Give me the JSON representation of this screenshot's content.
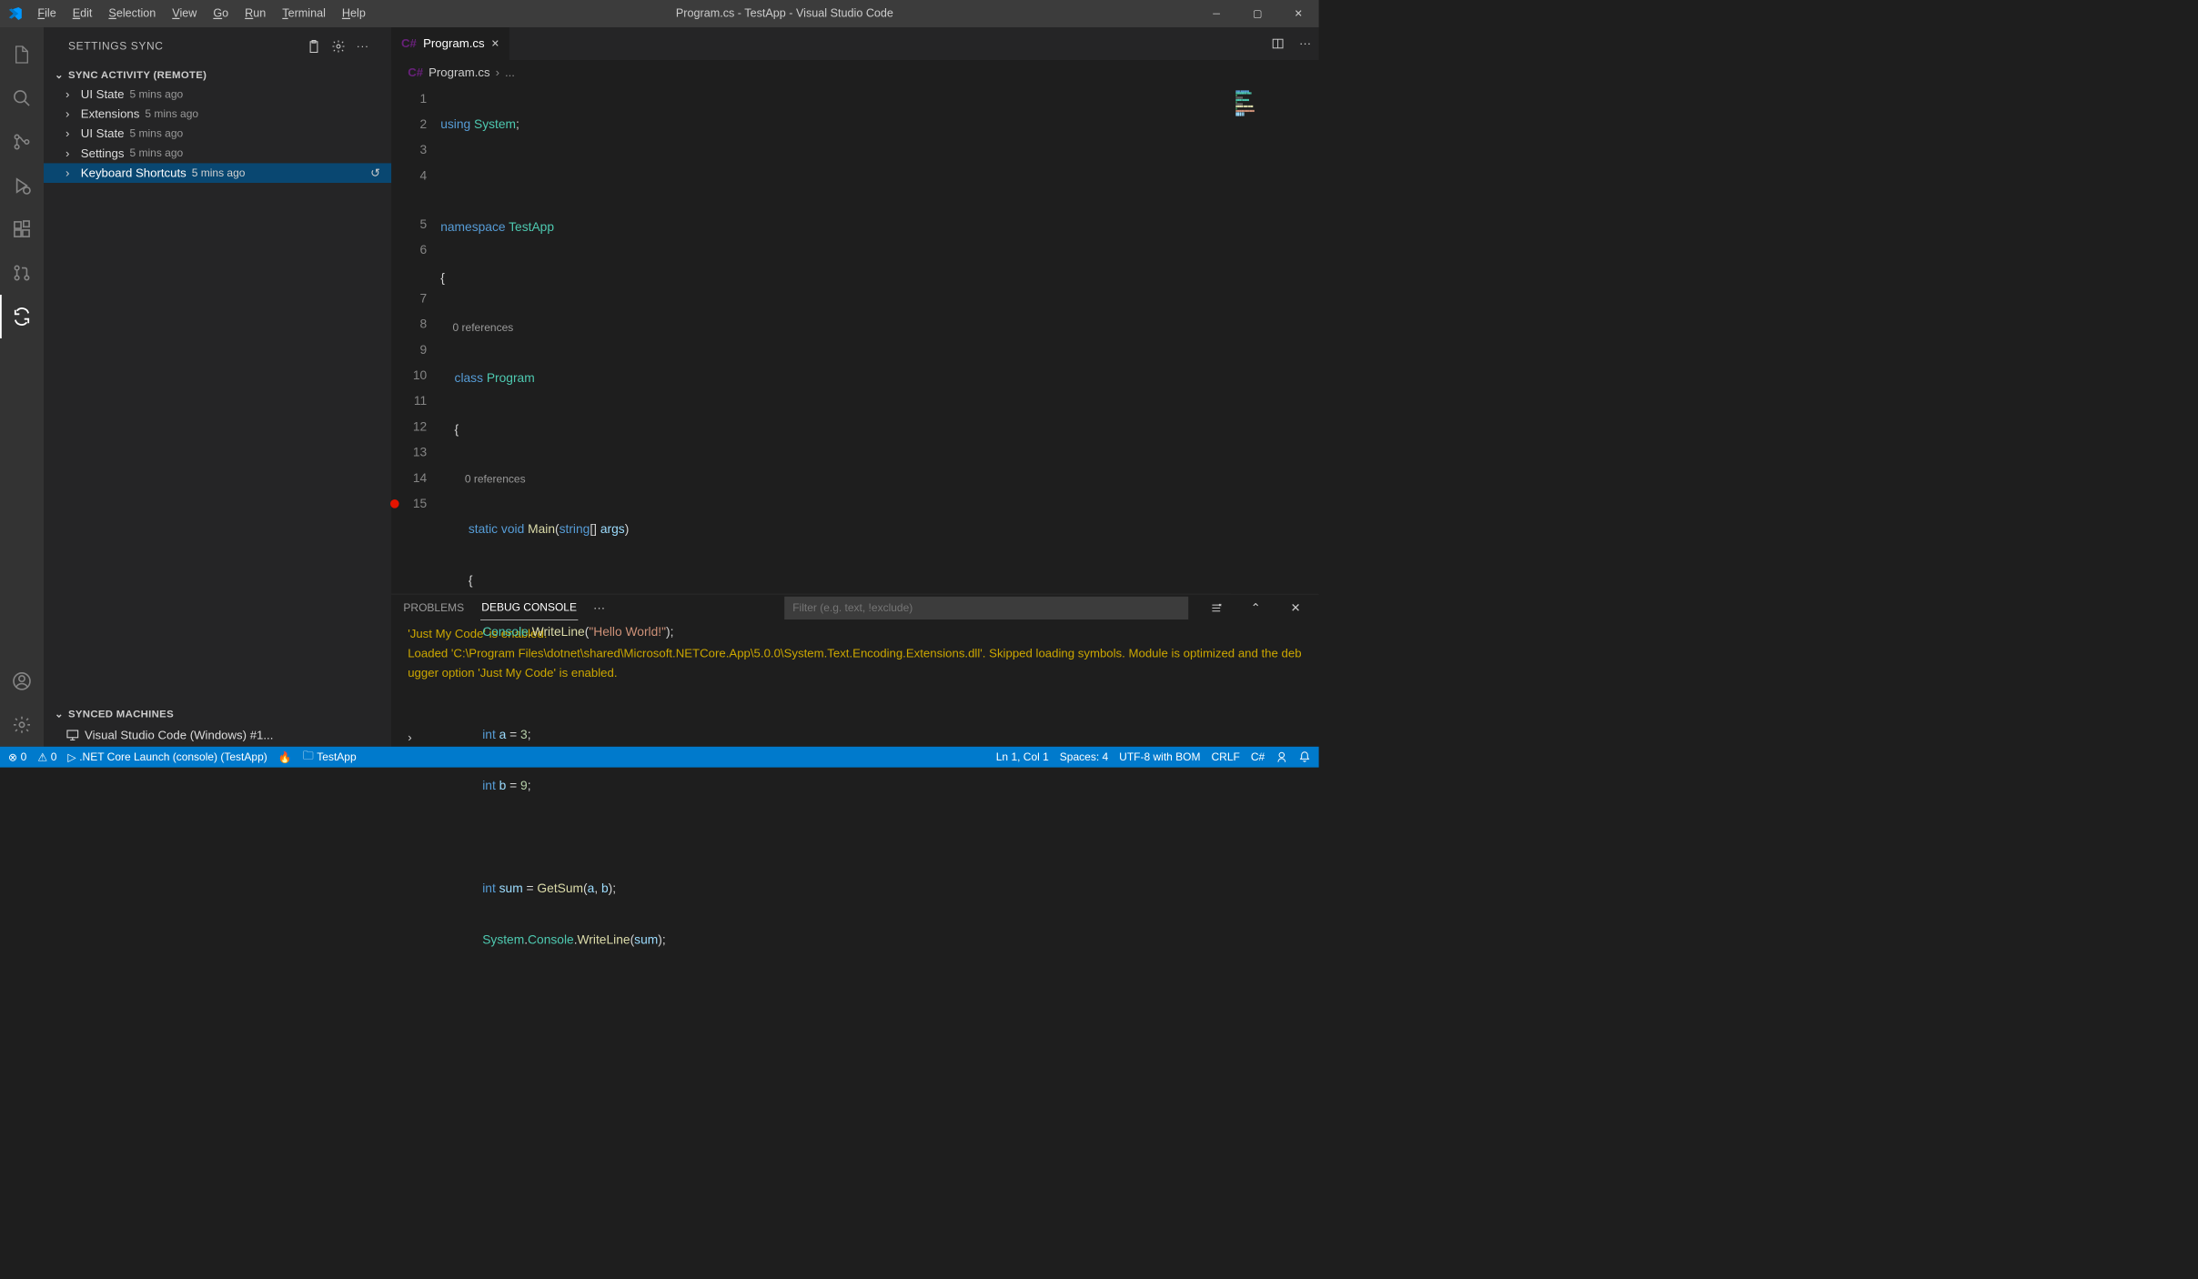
{
  "window": {
    "title": "Program.cs - TestApp - Visual Studio Code",
    "menu": [
      "File",
      "Edit",
      "Selection",
      "View",
      "Go",
      "Run",
      "Terminal",
      "Help"
    ]
  },
  "sidebar": {
    "header": "SETTINGS SYNC",
    "section1_title": "SYNC ACTIVITY (REMOTE)",
    "items": [
      {
        "label": "UI State",
        "ts": "5 mins ago"
      },
      {
        "label": "Extensions",
        "ts": "5 mins ago"
      },
      {
        "label": "UI State",
        "ts": "5 mins ago"
      },
      {
        "label": "Settings",
        "ts": "5 mins ago"
      },
      {
        "label": "Keyboard Shortcuts",
        "ts": "5 mins ago"
      }
    ],
    "section2_title": "SYNCED MACHINES",
    "machine": "Visual Studio Code (Windows) #1..."
  },
  "editor": {
    "tab_label": "Program.cs",
    "breadcrumb_file": "Program.cs",
    "breadcrumb_rest": "...",
    "lines": [
      "1",
      "2",
      "3",
      "4",
      "5",
      "6",
      "7",
      "8",
      "9",
      "10",
      "11",
      "12",
      "13",
      "14",
      "15"
    ],
    "codelens_refs": "0 references",
    "code": {
      "l1_kw": "using",
      "l1_cls": "System",
      "l3_kw": "namespace",
      "l3_cls": "TestApp",
      "l5_kw": "class",
      "l5_cls": "Program",
      "l7_kw1": "static",
      "l7_kw2": "void",
      "l7_fn": "Main",
      "l7_kw3": "string",
      "l7_var": "args",
      "l9_cls": "Console",
      "l9_fn": "WriteLine",
      "l9_str": "\"Hello World!\"",
      "l11_kw": "int",
      "l11_var": "a",
      "l11_num": "3",
      "l12_kw": "int",
      "l12_var": "b",
      "l12_num": "9",
      "l14_kw": "int",
      "l14_var": "sum",
      "l14_fn": "GetSum",
      "l14_a": "a",
      "l14_b": "b",
      "l15_cls1": "System",
      "l15_cls2": "Console",
      "l15_fn": "WriteLine",
      "l15_var": "sum"
    }
  },
  "panel": {
    "tabs": {
      "problems": "PROBLEMS",
      "debug": "DEBUG CONSOLE"
    },
    "filter_placeholder": "Filter (e.g. text, !exclude)",
    "output_l1": "'Just My Code' is enabled.",
    "output_l2": "Loaded 'C:\\Program Files\\dotnet\\shared\\Microsoft.NETCore.App\\5.0.0\\System.Text.Encoding.Extensions.dll'. Skipped loading symbols. Module is optimized and the debugger option 'Just My Code' is enabled."
  },
  "status": {
    "errors": "0",
    "warnings": "0",
    "launch": ".NET Core Launch (console) (TestApp)",
    "folder": "TestApp",
    "ln": "Ln 1, Col 1",
    "spaces": "Spaces: 4",
    "enc": "UTF-8 with BOM",
    "eol": "CRLF",
    "lang": "C#"
  }
}
